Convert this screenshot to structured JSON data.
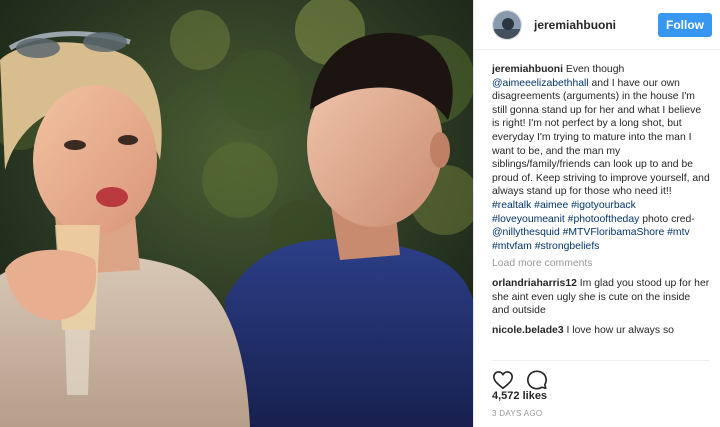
{
  "post": {
    "username": "jeremiahbuoni",
    "follow_label": "Follow",
    "caption": {
      "username": "jeremiahbuoni",
      "part1": "Even though",
      "mention": "@aimeeelizabethhall",
      "part2": "and I have our own disagreements (arguments) in the house I'm still gonna stand up for her and what I believe is right! I'm not perfect by a long shot, but everyday I'm trying to mature into the man I want to be, and the man my siblings/family/friends can look up to and be proud of. Keep striving to improve yourself, and always stand up for those who need it!!",
      "hashtags_line1": "#realtalk #aimee #igotyourback #loveyoumeanit #photooftheday",
      "photo_credit_label": "photo cred-",
      "credit_mention": "@nillythesquid",
      "hashtags_line2": "#MTVFloribamaShore #mtv #mtvfam #strongbeliefs"
    },
    "load_more": "Load more comments",
    "comments": [
      {
        "user": "orlandriaharris12",
        "text": "Im glad you stood up for her she aint even ugly she is cute on the inside and outside"
      },
      {
        "user": "nicole.belade3",
        "text": "I love how ur always so"
      }
    ],
    "likes": "4,572 likes",
    "date": "3 DAYS AGO"
  },
  "icons": {
    "like": "heart-icon",
    "comment": "comment-icon"
  },
  "colors": {
    "follow_button": "#3897f0",
    "link": "#003569",
    "muted": "#999999"
  }
}
